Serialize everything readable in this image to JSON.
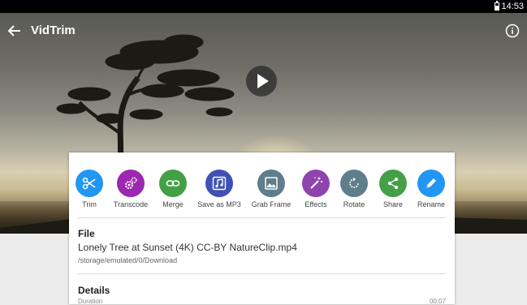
{
  "status_bar": {
    "time": "14:53"
  },
  "app_bar": {
    "title": "VidTrim"
  },
  "actions": [
    {
      "label": "Trim",
      "icon": "scissors-icon",
      "color": "#2196f3"
    },
    {
      "label": "Transcode",
      "icon": "gears-icon",
      "color": "#9c27b0"
    },
    {
      "label": "Merge",
      "icon": "link-icon",
      "color": "#43a047"
    },
    {
      "label": "Save as MP3",
      "icon": "music-icon",
      "color": "#3f51b5"
    },
    {
      "label": "Grab Frame",
      "icon": "image-icon",
      "color": "#607d8b"
    },
    {
      "label": "Effects",
      "icon": "magic-wand-icon",
      "color": "#8e44ad"
    },
    {
      "label": "Rotate",
      "icon": "rotate-icon",
      "color": "#607d8b"
    },
    {
      "label": "Share",
      "icon": "share-icon",
      "color": "#43a047"
    },
    {
      "label": "Rename",
      "icon": "pencil-icon",
      "color": "#2196f3"
    }
  ],
  "file": {
    "section_title": "File",
    "name": "Lonely Tree at Sunset (4K) CC-BY NatureClip.mp4",
    "path": "/storage/emulated/0/Download"
  },
  "details": {
    "section_title": "Details",
    "duration_label": "Duration",
    "duration_value": "00:07"
  }
}
